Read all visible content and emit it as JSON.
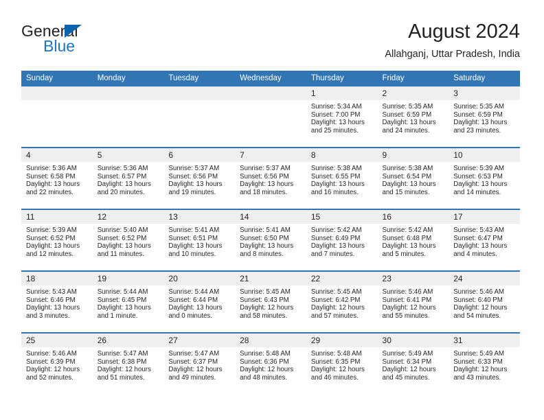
{
  "brand": {
    "name_part1": "General",
    "name_part2": "Blue",
    "triangle_color": "#0b64ad",
    "blue_color": "#1a76c4"
  },
  "header": {
    "title": "August 2024",
    "subtitle": "Allahganj, Uttar Pradesh, India"
  },
  "theme": {
    "header_blue": "#3275b5",
    "row_rule_blue": "#3275b5",
    "daynum_band": "#efefef",
    "text": "#231f20"
  },
  "weekdays": [
    "Sunday",
    "Monday",
    "Tuesday",
    "Wednesday",
    "Thursday",
    "Friday",
    "Saturday"
  ],
  "labels": {
    "sunrise_prefix": "Sunrise:",
    "sunset_prefix": "Sunset:",
    "daylight_prefix": "Daylight:"
  },
  "weeks": [
    [
      {
        "day": "",
        "sunrise": "",
        "sunset": "",
        "daylight_line1": "",
        "daylight_line2": ""
      },
      {
        "day": "",
        "sunrise": "",
        "sunset": "",
        "daylight_line1": "",
        "daylight_line2": ""
      },
      {
        "day": "",
        "sunrise": "",
        "sunset": "",
        "daylight_line1": "",
        "daylight_line2": ""
      },
      {
        "day": "",
        "sunrise": "",
        "sunset": "",
        "daylight_line1": "",
        "daylight_line2": ""
      },
      {
        "day": "1",
        "sunrise": "Sunrise: 5:34 AM",
        "sunset": "Sunset: 7:00 PM",
        "daylight_line1": "Daylight: 13 hours",
        "daylight_line2": "and 25 minutes."
      },
      {
        "day": "2",
        "sunrise": "Sunrise: 5:35 AM",
        "sunset": "Sunset: 6:59 PM",
        "daylight_line1": "Daylight: 13 hours",
        "daylight_line2": "and 24 minutes."
      },
      {
        "day": "3",
        "sunrise": "Sunrise: 5:35 AM",
        "sunset": "Sunset: 6:59 PM",
        "daylight_line1": "Daylight: 13 hours",
        "daylight_line2": "and 23 minutes."
      }
    ],
    [
      {
        "day": "4",
        "sunrise": "Sunrise: 5:36 AM",
        "sunset": "Sunset: 6:58 PM",
        "daylight_line1": "Daylight: 13 hours",
        "daylight_line2": "and 22 minutes."
      },
      {
        "day": "5",
        "sunrise": "Sunrise: 5:36 AM",
        "sunset": "Sunset: 6:57 PM",
        "daylight_line1": "Daylight: 13 hours",
        "daylight_line2": "and 20 minutes."
      },
      {
        "day": "6",
        "sunrise": "Sunrise: 5:37 AM",
        "sunset": "Sunset: 6:56 PM",
        "daylight_line1": "Daylight: 13 hours",
        "daylight_line2": "and 19 minutes."
      },
      {
        "day": "7",
        "sunrise": "Sunrise: 5:37 AM",
        "sunset": "Sunset: 6:56 PM",
        "daylight_line1": "Daylight: 13 hours",
        "daylight_line2": "and 18 minutes."
      },
      {
        "day": "8",
        "sunrise": "Sunrise: 5:38 AM",
        "sunset": "Sunset: 6:55 PM",
        "daylight_line1": "Daylight: 13 hours",
        "daylight_line2": "and 16 minutes."
      },
      {
        "day": "9",
        "sunrise": "Sunrise: 5:38 AM",
        "sunset": "Sunset: 6:54 PM",
        "daylight_line1": "Daylight: 13 hours",
        "daylight_line2": "and 15 minutes."
      },
      {
        "day": "10",
        "sunrise": "Sunrise: 5:39 AM",
        "sunset": "Sunset: 6:53 PM",
        "daylight_line1": "Daylight: 13 hours",
        "daylight_line2": "and 14 minutes."
      }
    ],
    [
      {
        "day": "11",
        "sunrise": "Sunrise: 5:39 AM",
        "sunset": "Sunset: 6:52 PM",
        "daylight_line1": "Daylight: 13 hours",
        "daylight_line2": "and 12 minutes."
      },
      {
        "day": "12",
        "sunrise": "Sunrise: 5:40 AM",
        "sunset": "Sunset: 6:52 PM",
        "daylight_line1": "Daylight: 13 hours",
        "daylight_line2": "and 11 minutes."
      },
      {
        "day": "13",
        "sunrise": "Sunrise: 5:41 AM",
        "sunset": "Sunset: 6:51 PM",
        "daylight_line1": "Daylight: 13 hours",
        "daylight_line2": "and 10 minutes."
      },
      {
        "day": "14",
        "sunrise": "Sunrise: 5:41 AM",
        "sunset": "Sunset: 6:50 PM",
        "daylight_line1": "Daylight: 13 hours",
        "daylight_line2": "and 8 minutes."
      },
      {
        "day": "15",
        "sunrise": "Sunrise: 5:42 AM",
        "sunset": "Sunset: 6:49 PM",
        "daylight_line1": "Daylight: 13 hours",
        "daylight_line2": "and 7 minutes."
      },
      {
        "day": "16",
        "sunrise": "Sunrise: 5:42 AM",
        "sunset": "Sunset: 6:48 PM",
        "daylight_line1": "Daylight: 13 hours",
        "daylight_line2": "and 5 minutes."
      },
      {
        "day": "17",
        "sunrise": "Sunrise: 5:43 AM",
        "sunset": "Sunset: 6:47 PM",
        "daylight_line1": "Daylight: 13 hours",
        "daylight_line2": "and 4 minutes."
      }
    ],
    [
      {
        "day": "18",
        "sunrise": "Sunrise: 5:43 AM",
        "sunset": "Sunset: 6:46 PM",
        "daylight_line1": "Daylight: 13 hours",
        "daylight_line2": "and 3 minutes."
      },
      {
        "day": "19",
        "sunrise": "Sunrise: 5:44 AM",
        "sunset": "Sunset: 6:45 PM",
        "daylight_line1": "Daylight: 13 hours",
        "daylight_line2": "and 1 minute."
      },
      {
        "day": "20",
        "sunrise": "Sunrise: 5:44 AM",
        "sunset": "Sunset: 6:44 PM",
        "daylight_line1": "Daylight: 13 hours",
        "daylight_line2": "and 0 minutes."
      },
      {
        "day": "21",
        "sunrise": "Sunrise: 5:45 AM",
        "sunset": "Sunset: 6:43 PM",
        "daylight_line1": "Daylight: 12 hours",
        "daylight_line2": "and 58 minutes."
      },
      {
        "day": "22",
        "sunrise": "Sunrise: 5:45 AM",
        "sunset": "Sunset: 6:42 PM",
        "daylight_line1": "Daylight: 12 hours",
        "daylight_line2": "and 57 minutes."
      },
      {
        "day": "23",
        "sunrise": "Sunrise: 5:46 AM",
        "sunset": "Sunset: 6:41 PM",
        "daylight_line1": "Daylight: 12 hours",
        "daylight_line2": "and 55 minutes."
      },
      {
        "day": "24",
        "sunrise": "Sunrise: 5:46 AM",
        "sunset": "Sunset: 6:40 PM",
        "daylight_line1": "Daylight: 12 hours",
        "daylight_line2": "and 54 minutes."
      }
    ],
    [
      {
        "day": "25",
        "sunrise": "Sunrise: 5:46 AM",
        "sunset": "Sunset: 6:39 PM",
        "daylight_line1": "Daylight: 12 hours",
        "daylight_line2": "and 52 minutes."
      },
      {
        "day": "26",
        "sunrise": "Sunrise: 5:47 AM",
        "sunset": "Sunset: 6:38 PM",
        "daylight_line1": "Daylight: 12 hours",
        "daylight_line2": "and 51 minutes."
      },
      {
        "day": "27",
        "sunrise": "Sunrise: 5:47 AM",
        "sunset": "Sunset: 6:37 PM",
        "daylight_line1": "Daylight: 12 hours",
        "daylight_line2": "and 49 minutes."
      },
      {
        "day": "28",
        "sunrise": "Sunrise: 5:48 AM",
        "sunset": "Sunset: 6:36 PM",
        "daylight_line1": "Daylight: 12 hours",
        "daylight_line2": "and 48 minutes."
      },
      {
        "day": "29",
        "sunrise": "Sunrise: 5:48 AM",
        "sunset": "Sunset: 6:35 PM",
        "daylight_line1": "Daylight: 12 hours",
        "daylight_line2": "and 46 minutes."
      },
      {
        "day": "30",
        "sunrise": "Sunrise: 5:49 AM",
        "sunset": "Sunset: 6:34 PM",
        "daylight_line1": "Daylight: 12 hours",
        "daylight_line2": "and 45 minutes."
      },
      {
        "day": "31",
        "sunrise": "Sunrise: 5:49 AM",
        "sunset": "Sunset: 6:33 PM",
        "daylight_line1": "Daylight: 12 hours",
        "daylight_line2": "and 43 minutes."
      }
    ]
  ]
}
